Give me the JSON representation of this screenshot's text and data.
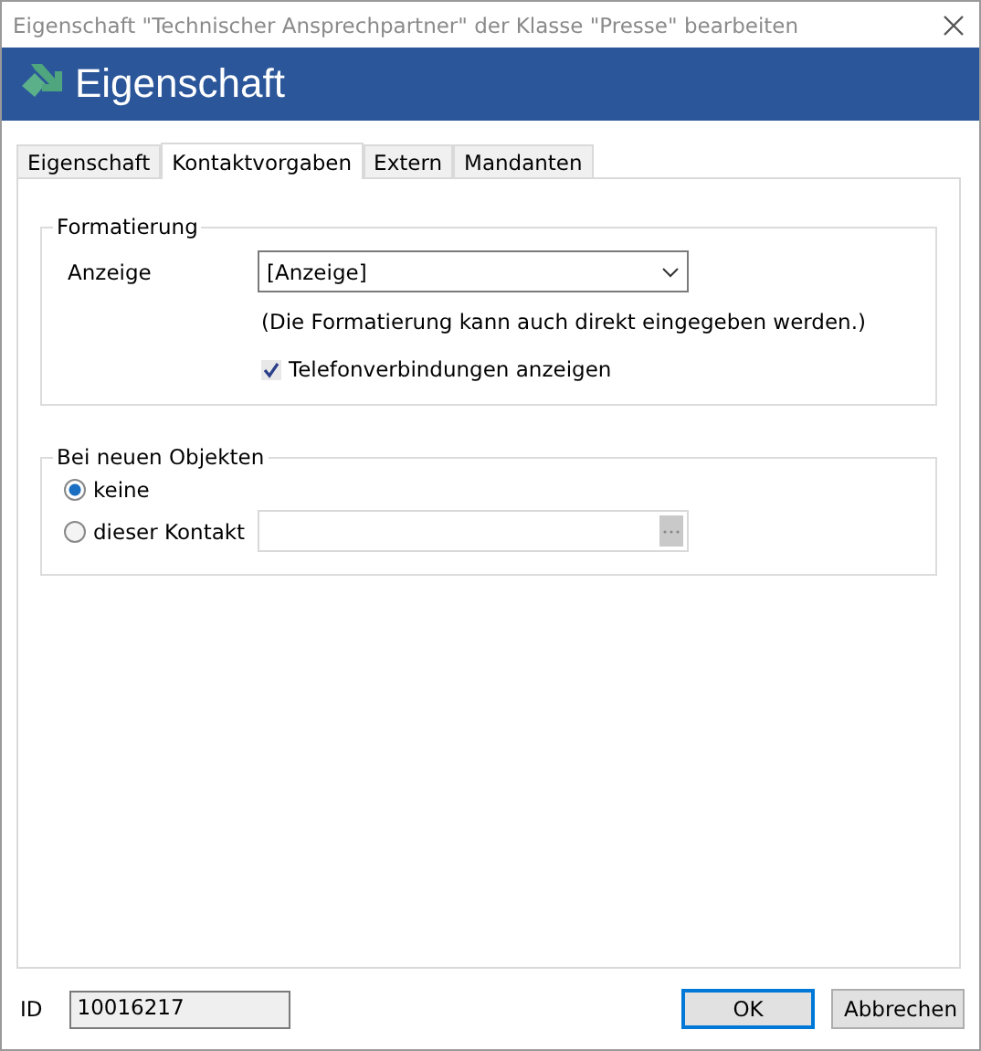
{
  "window": {
    "title": "Eigenschaft \"Technischer Ansprechpartner\" der Klasse \"Presse\" bearbeiten"
  },
  "header": {
    "title": "Eigenschaft"
  },
  "tabs": [
    {
      "label": "Eigenschaft",
      "selected": false
    },
    {
      "label": "Kontaktvorgaben",
      "selected": true
    },
    {
      "label": "Extern",
      "selected": false
    },
    {
      "label": "Mandanten",
      "selected": false
    }
  ],
  "formatierung": {
    "legend": "Formatierung",
    "label": "Anzeige",
    "value": "[Anzeige]",
    "hint": "(Die Formatierung kann auch direkt eingegeben werden.)",
    "checkbox": {
      "label": "Telefonverbindungen anzeigen",
      "checked": true
    }
  },
  "neue_objekte": {
    "legend": "Bei neuen Objekten",
    "options": [
      {
        "label": "keine",
        "selected": true
      },
      {
        "label": "dieser Kontakt",
        "selected": false
      }
    ]
  },
  "footer": {
    "id_label": "ID",
    "id_value": "10016217",
    "buttons": [
      {
        "label": "OK",
        "default": true
      },
      {
        "label": "Abbrechen",
        "default": false
      }
    ]
  }
}
